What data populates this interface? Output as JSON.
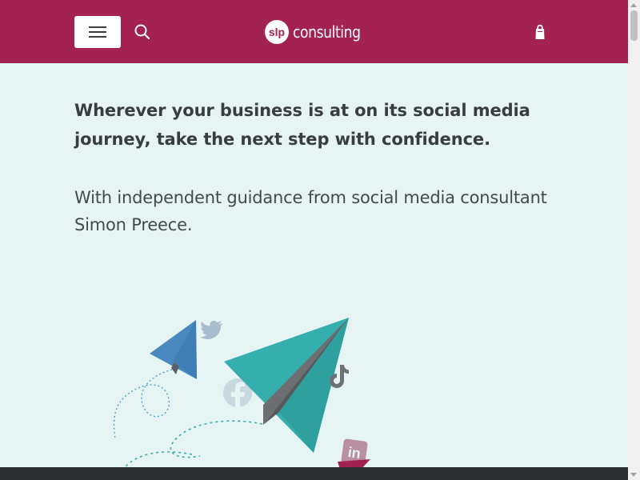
{
  "header": {
    "logo_mark": "slp",
    "logo_text": "consulting",
    "icons": {
      "menu": "hamburger-menu-icon",
      "search": "search-icon",
      "cart": "shopping-bag-icon"
    },
    "colors": {
      "brand": "#a42252"
    }
  },
  "main": {
    "headline": "Wherever your business is at on its social media journey, take the next step with confidence.",
    "subline": "With independent guidance from social media consultant Simon Preece."
  },
  "illustration": {
    "icons": [
      "twitter-icon",
      "facebook-icon",
      "tiktok-icon",
      "linkedin-icon"
    ],
    "colors": {
      "small_plane": "#4a89c0",
      "large_plane": "#35aeae",
      "trail": "#4aa6c9"
    }
  },
  "colors": {
    "page_background": "#e6f5f4",
    "footer": "#2e2f33"
  }
}
